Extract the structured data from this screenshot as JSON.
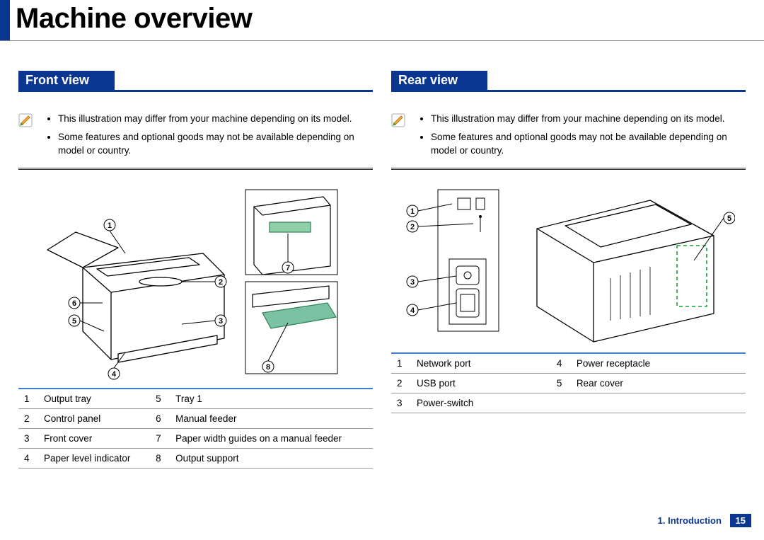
{
  "title": "Machine overview",
  "sections": {
    "front": {
      "heading": "Front view",
      "notes": [
        "This illustration may differ from your machine depending on its model.",
        "Some features and optional goods may not be available depending on model or country."
      ],
      "parts": [
        {
          "num": "1",
          "label": "Output tray"
        },
        {
          "num": "2",
          "label": "Control panel"
        },
        {
          "num": "3",
          "label": "Front cover"
        },
        {
          "num": "4",
          "label": "Paper level indicator"
        },
        {
          "num": "5",
          "label": "Tray 1"
        },
        {
          "num": "6",
          "label": "Manual feeder"
        },
        {
          "num": "7",
          "label": "Paper width guides on a manual feeder"
        },
        {
          "num": "8",
          "label": "Output support"
        }
      ]
    },
    "rear": {
      "heading": "Rear view",
      "notes": [
        "This illustration may differ from your machine depending on its model.",
        "Some features and optional goods may not be available depending on model or country."
      ],
      "parts": [
        {
          "num": "1",
          "label": "Network port"
        },
        {
          "num": "2",
          "label": "USB port"
        },
        {
          "num": "3",
          "label": "Power-switch"
        },
        {
          "num": "4",
          "label": "Power receptacle"
        },
        {
          "num": "5",
          "label": "Rear cover"
        }
      ]
    }
  },
  "diagram_labels": {
    "front": {
      "c1": "1",
      "c2": "2",
      "c3": "3",
      "c4": "4",
      "c5": "5",
      "c6": "6",
      "c7": "7",
      "c8": "8"
    },
    "rear": {
      "c1": "1",
      "c2": "2",
      "c3": "3",
      "c4": "4",
      "c5": "5"
    }
  },
  "footer": {
    "chapter": "1. Introduction",
    "page": "15"
  }
}
